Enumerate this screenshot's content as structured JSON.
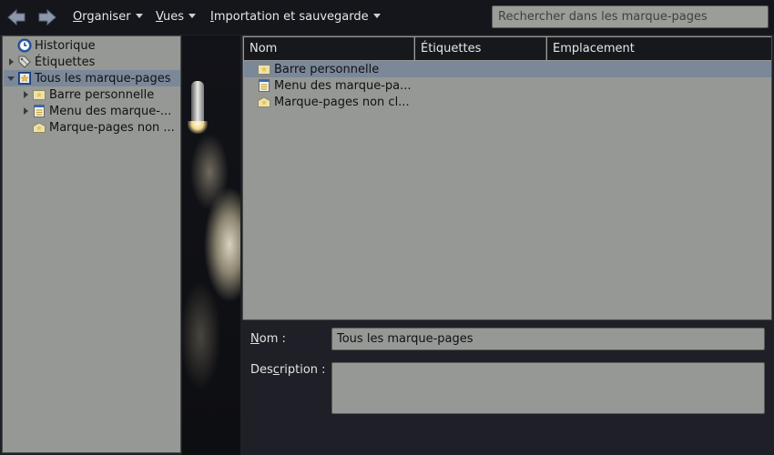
{
  "toolbar": {
    "back_icon": "back-arrow-icon",
    "forward_icon": "forward-arrow-icon",
    "menus": [
      {
        "label": "Organiser",
        "accel": "O"
      },
      {
        "label": "Vues",
        "accel": "V"
      },
      {
        "label": "Importation et sauvegarde",
        "accel": "I"
      }
    ],
    "search_placeholder": "Rechercher dans les marque-pages"
  },
  "sidebar": {
    "items": [
      {
        "label": "Historique",
        "icon": "clock-icon"
      },
      {
        "label": "Étiquettes",
        "icon": "tag-icon"
      },
      {
        "label": "Tous les marque-pages",
        "icon": "bookmarks-icon"
      },
      {
        "label": "Barre personnelle",
        "icon": "folder-star-icon"
      },
      {
        "label": "Menu des marque-...",
        "icon": "menu-list-icon"
      },
      {
        "label": "Marque-pages non ...",
        "icon": "unsorted-bookmarks-icon"
      }
    ]
  },
  "list": {
    "columns": [
      "Nom",
      "Étiquettes",
      "Emplacement"
    ],
    "rows": [
      {
        "name": "Barre personnelle",
        "icon": "folder-star-icon"
      },
      {
        "name": "Menu des marque-pa...",
        "icon": "menu-list-icon"
      },
      {
        "name": "Marque-pages non cl...",
        "icon": "unsorted-bookmarks-icon"
      }
    ]
  },
  "details": {
    "name_label_accel": "N",
    "name_label_rest": "om :",
    "name_value": "Tous les marque-pages",
    "desc_label_pre": "Des",
    "desc_label_accel": "c",
    "desc_label_rest": "ription :",
    "desc_value": ""
  },
  "colors": {
    "pane_bg": "#969895",
    "selection": "#7b889a",
    "toolbar_bg": "#15161b"
  }
}
